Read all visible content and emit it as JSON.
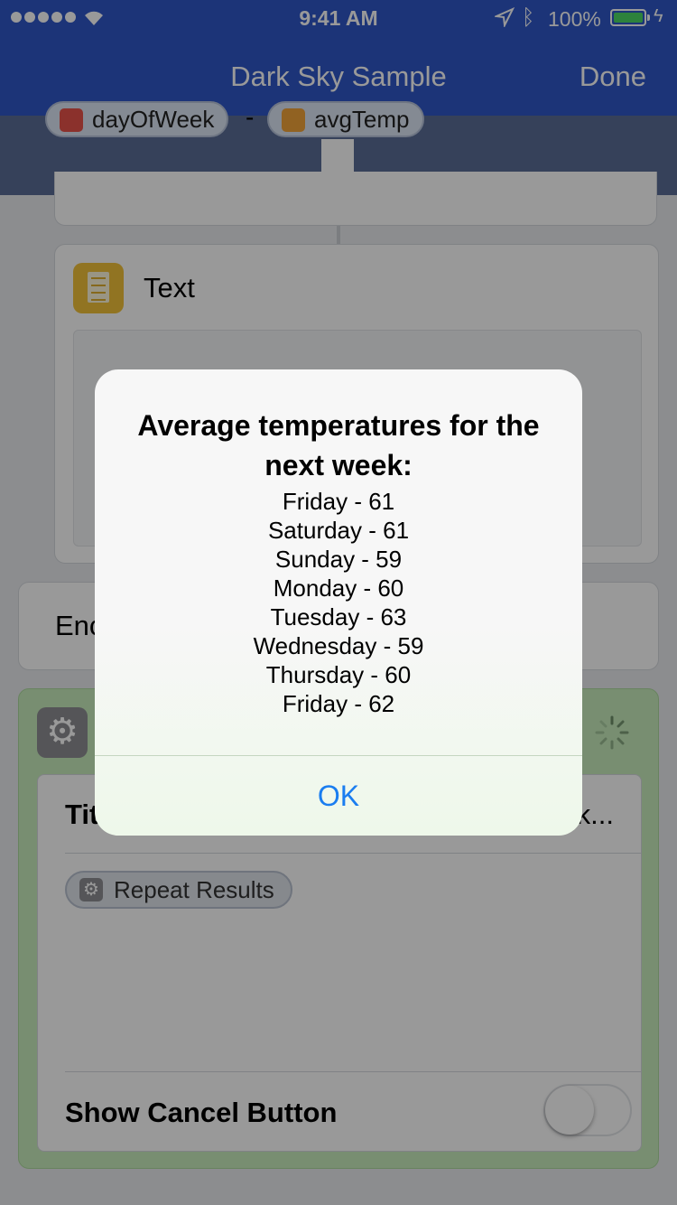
{
  "status_bar": {
    "time": "9:41 AM",
    "battery_percent": "100%",
    "signal_bars": 5,
    "battery_level": 1.0
  },
  "nav": {
    "title": "Dark Sky Sample",
    "done_label": "Done"
  },
  "workflow": {
    "text_action": {
      "title": "Text",
      "tokens": [
        "dayOfWeek",
        "avgTemp"
      ],
      "separator": "-"
    },
    "end_action": {
      "label_visible": "Enc"
    },
    "menu_action": {
      "title_label": "Tit",
      "title_value_tail": "k...",
      "repeat_token": "Repeat Results",
      "show_cancel_label": "Show Cancel Button",
      "show_cancel_on": false
    }
  },
  "alert": {
    "heading": "Average temperatures for the next week:",
    "lines": [
      "Friday - 61",
      "Saturday - 61",
      "Sunday - 59",
      "Monday - 60",
      "Tuesday - 63",
      "Wednesday - 59",
      "Thursday - 60",
      "Friday - 62"
    ],
    "ok_label": "OK"
  },
  "colors": {
    "nav_blue": "#2f57c9",
    "accent_green": "#c8edbd",
    "link_blue": "#1a7df0"
  }
}
